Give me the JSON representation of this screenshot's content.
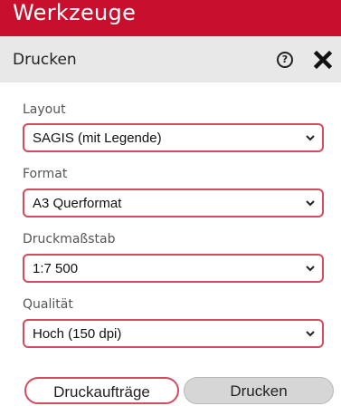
{
  "header": {
    "title": "Werkzeuge"
  },
  "panel": {
    "title": "Drucken",
    "help_icon": "question-circle-icon",
    "close_icon": "close-x-icon"
  },
  "form": {
    "layout": {
      "label": "Layout",
      "value": "SAGIS (mit Legende)"
    },
    "format": {
      "label": "Format",
      "value": "A3 Querformat"
    },
    "scale": {
      "label": "Druckmaßstab",
      "value": "1:7 500"
    },
    "quality": {
      "label": "Qualität",
      "value": "Hoch (150 dpi)"
    }
  },
  "buttons": {
    "jobs": "Druckaufträge",
    "print": "Drucken"
  },
  "colors": {
    "header_bg": "#c8102e",
    "subheader_bg": "#e8e8e8",
    "field_border": "#d24b5e",
    "print_button_bg": "#d6d6d6"
  }
}
